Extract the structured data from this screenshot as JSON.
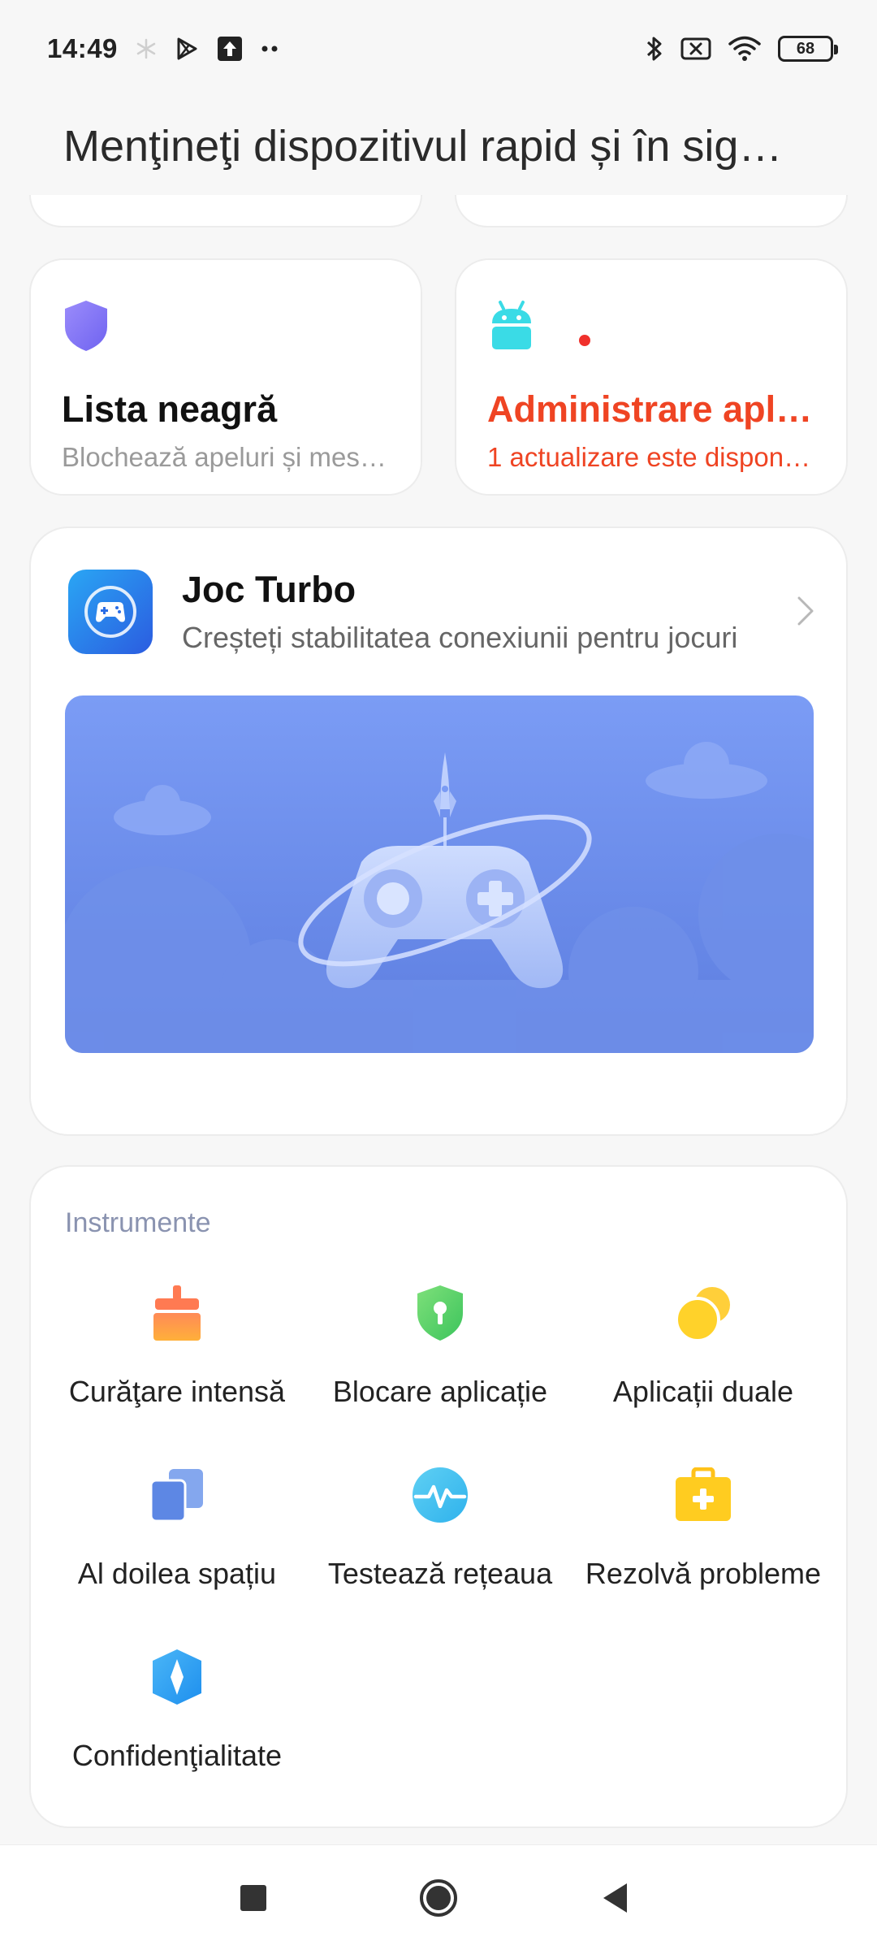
{
  "status_bar": {
    "time": "14:49",
    "left_icons": [
      "snowflake-icon",
      "play-store-icon",
      "upload-icon",
      "more-dots-icon"
    ],
    "right_icons": [
      "bluetooth-icon",
      "no-sim-icon",
      "wifi-icon",
      "battery-icon"
    ],
    "battery_level": "68"
  },
  "header": {
    "title": "Menţineţi dispozitivul rapid și în sig…"
  },
  "cards": {
    "blacklist": {
      "icon": "shield-icon",
      "title": "Lista neagră",
      "subtitle": "Blochează apeluri și mesaje"
    },
    "app_management": {
      "icon": "android-icon",
      "title": "Administrare apli…",
      "subtitle": "1 actualizare este disponib…",
      "accent": "#ef4423"
    }
  },
  "game_turbo": {
    "title": "Joc Turbo",
    "subtitle": "Creșteți stabilitatea conexiunii pentru jocuri",
    "icon": "gamepad-icon",
    "banner_colors": [
      "#7b9cf5",
      "#5d7ee0"
    ]
  },
  "tools": {
    "heading": "Instrumente",
    "items": [
      {
        "label": "Curăţare intensă",
        "icon": "broom-icon"
      },
      {
        "label": "Blocare aplicație",
        "icon": "lock-shield-icon"
      },
      {
        "label": "Aplicații duale",
        "icon": "dual-circles-icon"
      },
      {
        "label": "Al doilea spațiu",
        "icon": "second-space-icon"
      },
      {
        "label": "Testează rețeaua",
        "icon": "network-pulse-icon"
      },
      {
        "label": "Rezolvă probleme",
        "icon": "first-aid-icon"
      },
      {
        "label": "Confidenţialitate",
        "icon": "privacy-icon"
      }
    ]
  },
  "nav_bar": {
    "buttons": [
      "recents-square-icon",
      "home-circle-icon",
      "back-triangle-icon"
    ]
  }
}
